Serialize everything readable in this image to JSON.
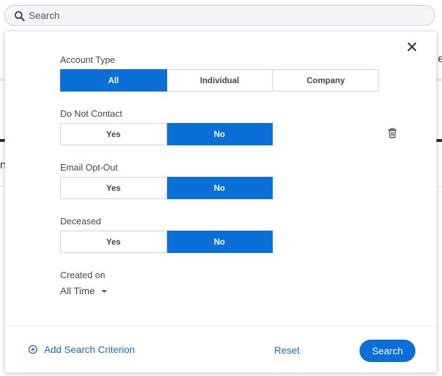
{
  "search": {
    "placeholder": "Search"
  },
  "background": {
    "fragment_left": "n",
    "fragment_right": "e"
  },
  "filters": {
    "account_type": {
      "label": "Account Type",
      "options": [
        "All",
        "Individual",
        "Company"
      ],
      "selected": "All"
    },
    "do_not_contact": {
      "label": "Do Not Contact",
      "options": [
        "Yes",
        "No"
      ],
      "selected": "No"
    },
    "email_opt_out": {
      "label": "Email Opt-Out",
      "options": [
        "Yes",
        "No"
      ],
      "selected": "No"
    },
    "deceased": {
      "label": "Deceased",
      "options": [
        "Yes",
        "No"
      ],
      "selected": "No"
    },
    "created_on": {
      "label": "Created on",
      "value": "All Time"
    }
  },
  "footer": {
    "add_label": "Add Search Criterion",
    "reset_label": "Reset",
    "search_label": "Search"
  },
  "icons": {
    "search": "search-icon",
    "close": "close-icon",
    "trash": "trash-icon",
    "add": "plus-circle-icon",
    "dropdown": "caret-down-icon"
  },
  "colors": {
    "accent": "#0a6fd6",
    "link": "#1668c8",
    "text": "#3f4652",
    "border": "#cfd3d9",
    "header_band": "#1d2d44"
  }
}
